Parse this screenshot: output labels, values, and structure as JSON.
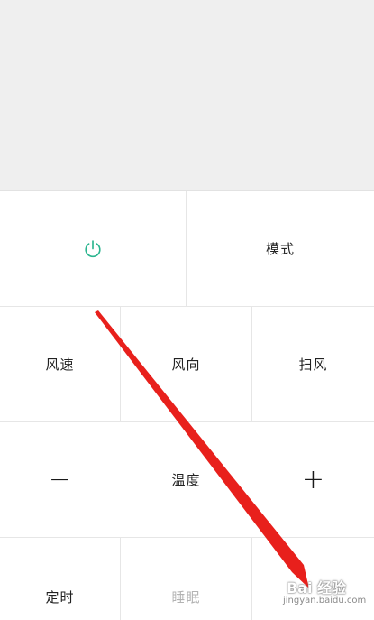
{
  "remote": {
    "power_icon": "power-icon",
    "accent_color": "#2bb58f",
    "rows": [
      [
        {
          "label": "",
          "icon": "power-icon"
        },
        {
          "label": "模式"
        }
      ],
      [
        {
          "label": "风速"
        },
        {
          "label": "风向"
        },
        {
          "label": "扫风"
        }
      ],
      [
        {
          "label": "−",
          "icon": "minus-icon"
        },
        {
          "label": "温度"
        },
        {
          "label": "+",
          "icon": "plus-icon"
        }
      ],
      [
        {
          "label": "定时"
        },
        {
          "label": "睡眠"
        },
        {
          "label": ""
        }
      ]
    ]
  },
  "keys": {
    "mode": "模式",
    "fan_speed": "风速",
    "wind_direction": "风向",
    "swing": "扫风",
    "minus": "−",
    "temperature": "温度",
    "plus": "+",
    "timer": "定时",
    "sleep": "睡眠"
  },
  "watermark": {
    "title": "Bai 经验",
    "url": "jingyan.baidu.com"
  }
}
